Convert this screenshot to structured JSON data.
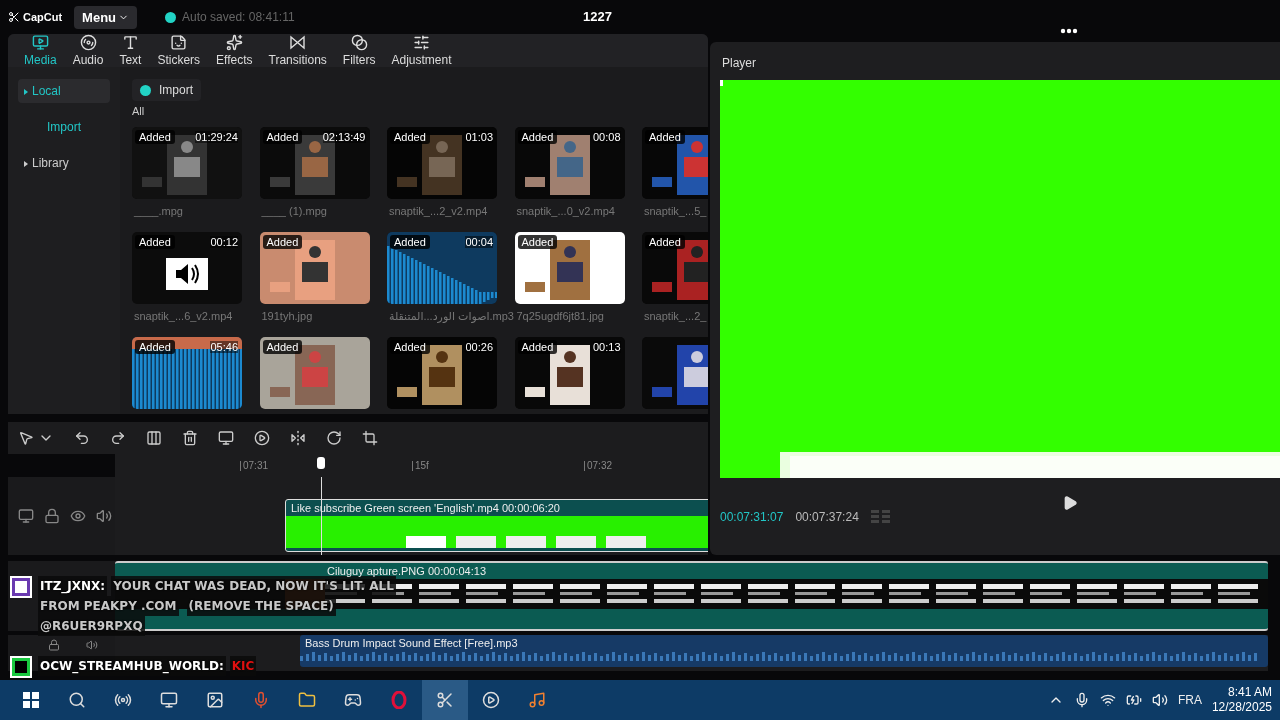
{
  "topbar": {
    "logo": "CapCut",
    "menu": "Menu",
    "autosave": "Auto saved: 08:41:11",
    "project_title": "1227"
  },
  "tabs": [
    {
      "label": "Media",
      "selected": true
    },
    {
      "label": "Audio",
      "selected": false
    },
    {
      "label": "Text",
      "selected": false
    },
    {
      "label": "Stickers",
      "selected": false
    },
    {
      "label": "Effects",
      "selected": false
    },
    {
      "label": "Transitions",
      "selected": false
    },
    {
      "label": "Filters",
      "selected": false
    },
    {
      "label": "Adjustment",
      "selected": false
    }
  ],
  "sidebar": [
    {
      "label": "Local",
      "kind": "group",
      "selected": true
    },
    {
      "label": "Import",
      "kind": "link",
      "selected": false
    },
    {
      "label": "Library",
      "kind": "group",
      "selected": false
    }
  ],
  "import_button": "Import",
  "filter": "All",
  "media": [
    {
      "kind": "picture",
      "badge": "Added",
      "duration": "01:29:24",
      "name": "____.mpg"
    },
    {
      "kind": "picture",
      "badge": "Added",
      "duration": "02:13:49",
      "name": "____ (1).mpg"
    },
    {
      "kind": "picture",
      "badge": "Added",
      "duration": "01:03",
      "name": "snaptik_...2_v2.mp4"
    },
    {
      "kind": "picture",
      "badge": "Added",
      "duration": "00:08",
      "name": "snaptik_...0_v2.mp4"
    },
    {
      "kind": "picture",
      "badge": "Added",
      "name": "snaptik_...5_"
    },
    {
      "kind": "speaker",
      "badge": "Added",
      "duration": "00:12",
      "name": "snaptik_...6_v2.mp4"
    },
    {
      "kind": "picture",
      "badge": "Added",
      "name": "191tyh.jpg"
    },
    {
      "kind": "waveform",
      "badge": "Added",
      "duration": "00:04",
      "name": "اصوات الورد...المتنقلة.mp3"
    },
    {
      "kind": "picture",
      "badge": "Added",
      "name": "7q25ugdf6jt81.jpg"
    },
    {
      "kind": "picture",
      "badge": "Added",
      "name": "snaptik_...2_"
    },
    {
      "kind": "waveform",
      "badge": "Added",
      "duration": "05:46"
    },
    {
      "kind": "picture",
      "badge": "Added"
    },
    {
      "kind": "picture",
      "badge": "Added",
      "duration": "00:26"
    },
    {
      "kind": "picture",
      "badge": "Added",
      "duration": "00:13"
    },
    {
      "kind": "picture"
    }
  ],
  "timeline": {
    "ruler": [
      "07:31",
      "15f",
      "07:32"
    ],
    "main_clip": {
      "name": "Like subscribe Green screen 'English'.mp4",
      "duration": "00:00:06:20"
    },
    "overlay_clip": {
      "name": "Ciluguy apture.PNG",
      "duration": "00:00:04:13"
    },
    "audio_clip": {
      "name": "Bass Drum Impact Sound Effect [Free].mp3"
    }
  },
  "player": {
    "title": "Player",
    "current_time": "00:07:31:07",
    "total_time": "00:07:37:24"
  },
  "chat": [
    {
      "user": "ITZ_JXNX:",
      "lines": [
        "YOUR CHAT WAS DEAD, NOW IT'S LIT. ALL",
        "FROM PEAKPY .COM",
        "(REMOVE THE SPACE)",
        "@R6UER9RPXQ"
      ]
    },
    {
      "user": "OCW_STREAMHUB_WORLD:",
      "lines": [
        "KIC"
      ]
    }
  ],
  "taskbar": {
    "language": "FRA",
    "time": "8:41 AM",
    "date": "12/28/2025"
  }
}
